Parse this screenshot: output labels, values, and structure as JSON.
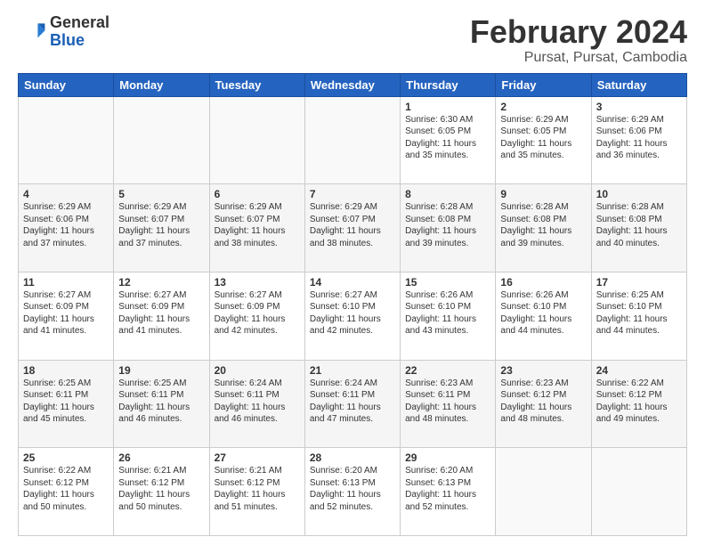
{
  "header": {
    "logo_general": "General",
    "logo_blue": "Blue",
    "main_title": "February 2024",
    "subtitle": "Pursat, Pursat, Cambodia"
  },
  "days_of_week": [
    "Sunday",
    "Monday",
    "Tuesday",
    "Wednesday",
    "Thursday",
    "Friday",
    "Saturday"
  ],
  "weeks": [
    [
      {
        "num": "",
        "info": ""
      },
      {
        "num": "",
        "info": ""
      },
      {
        "num": "",
        "info": ""
      },
      {
        "num": "",
        "info": ""
      },
      {
        "num": "1",
        "info": "Sunrise: 6:30 AM\nSunset: 6:05 PM\nDaylight: 11 hours\nand 35 minutes."
      },
      {
        "num": "2",
        "info": "Sunrise: 6:29 AM\nSunset: 6:05 PM\nDaylight: 11 hours\nand 35 minutes."
      },
      {
        "num": "3",
        "info": "Sunrise: 6:29 AM\nSunset: 6:06 PM\nDaylight: 11 hours\nand 36 minutes."
      }
    ],
    [
      {
        "num": "4",
        "info": "Sunrise: 6:29 AM\nSunset: 6:06 PM\nDaylight: 11 hours\nand 37 minutes."
      },
      {
        "num": "5",
        "info": "Sunrise: 6:29 AM\nSunset: 6:07 PM\nDaylight: 11 hours\nand 37 minutes."
      },
      {
        "num": "6",
        "info": "Sunrise: 6:29 AM\nSunset: 6:07 PM\nDaylight: 11 hours\nand 38 minutes."
      },
      {
        "num": "7",
        "info": "Sunrise: 6:29 AM\nSunset: 6:07 PM\nDaylight: 11 hours\nand 38 minutes."
      },
      {
        "num": "8",
        "info": "Sunrise: 6:28 AM\nSunset: 6:08 PM\nDaylight: 11 hours\nand 39 minutes."
      },
      {
        "num": "9",
        "info": "Sunrise: 6:28 AM\nSunset: 6:08 PM\nDaylight: 11 hours\nand 39 minutes."
      },
      {
        "num": "10",
        "info": "Sunrise: 6:28 AM\nSunset: 6:08 PM\nDaylight: 11 hours\nand 40 minutes."
      }
    ],
    [
      {
        "num": "11",
        "info": "Sunrise: 6:27 AM\nSunset: 6:09 PM\nDaylight: 11 hours\nand 41 minutes."
      },
      {
        "num": "12",
        "info": "Sunrise: 6:27 AM\nSunset: 6:09 PM\nDaylight: 11 hours\nand 41 minutes."
      },
      {
        "num": "13",
        "info": "Sunrise: 6:27 AM\nSunset: 6:09 PM\nDaylight: 11 hours\nand 42 minutes."
      },
      {
        "num": "14",
        "info": "Sunrise: 6:27 AM\nSunset: 6:10 PM\nDaylight: 11 hours\nand 42 minutes."
      },
      {
        "num": "15",
        "info": "Sunrise: 6:26 AM\nSunset: 6:10 PM\nDaylight: 11 hours\nand 43 minutes."
      },
      {
        "num": "16",
        "info": "Sunrise: 6:26 AM\nSunset: 6:10 PM\nDaylight: 11 hours\nand 44 minutes."
      },
      {
        "num": "17",
        "info": "Sunrise: 6:25 AM\nSunset: 6:10 PM\nDaylight: 11 hours\nand 44 minutes."
      }
    ],
    [
      {
        "num": "18",
        "info": "Sunrise: 6:25 AM\nSunset: 6:11 PM\nDaylight: 11 hours\nand 45 minutes."
      },
      {
        "num": "19",
        "info": "Sunrise: 6:25 AM\nSunset: 6:11 PM\nDaylight: 11 hours\nand 46 minutes."
      },
      {
        "num": "20",
        "info": "Sunrise: 6:24 AM\nSunset: 6:11 PM\nDaylight: 11 hours\nand 46 minutes."
      },
      {
        "num": "21",
        "info": "Sunrise: 6:24 AM\nSunset: 6:11 PM\nDaylight: 11 hours\nand 47 minutes."
      },
      {
        "num": "22",
        "info": "Sunrise: 6:23 AM\nSunset: 6:11 PM\nDaylight: 11 hours\nand 48 minutes."
      },
      {
        "num": "23",
        "info": "Sunrise: 6:23 AM\nSunset: 6:12 PM\nDaylight: 11 hours\nand 48 minutes."
      },
      {
        "num": "24",
        "info": "Sunrise: 6:22 AM\nSunset: 6:12 PM\nDaylight: 11 hours\nand 49 minutes."
      }
    ],
    [
      {
        "num": "25",
        "info": "Sunrise: 6:22 AM\nSunset: 6:12 PM\nDaylight: 11 hours\nand 50 minutes."
      },
      {
        "num": "26",
        "info": "Sunrise: 6:21 AM\nSunset: 6:12 PM\nDaylight: 11 hours\nand 50 minutes."
      },
      {
        "num": "27",
        "info": "Sunrise: 6:21 AM\nSunset: 6:12 PM\nDaylight: 11 hours\nand 51 minutes."
      },
      {
        "num": "28",
        "info": "Sunrise: 6:20 AM\nSunset: 6:13 PM\nDaylight: 11 hours\nand 52 minutes."
      },
      {
        "num": "29",
        "info": "Sunrise: 6:20 AM\nSunset: 6:13 PM\nDaylight: 11 hours\nand 52 minutes."
      },
      {
        "num": "",
        "info": ""
      },
      {
        "num": "",
        "info": ""
      }
    ]
  ]
}
